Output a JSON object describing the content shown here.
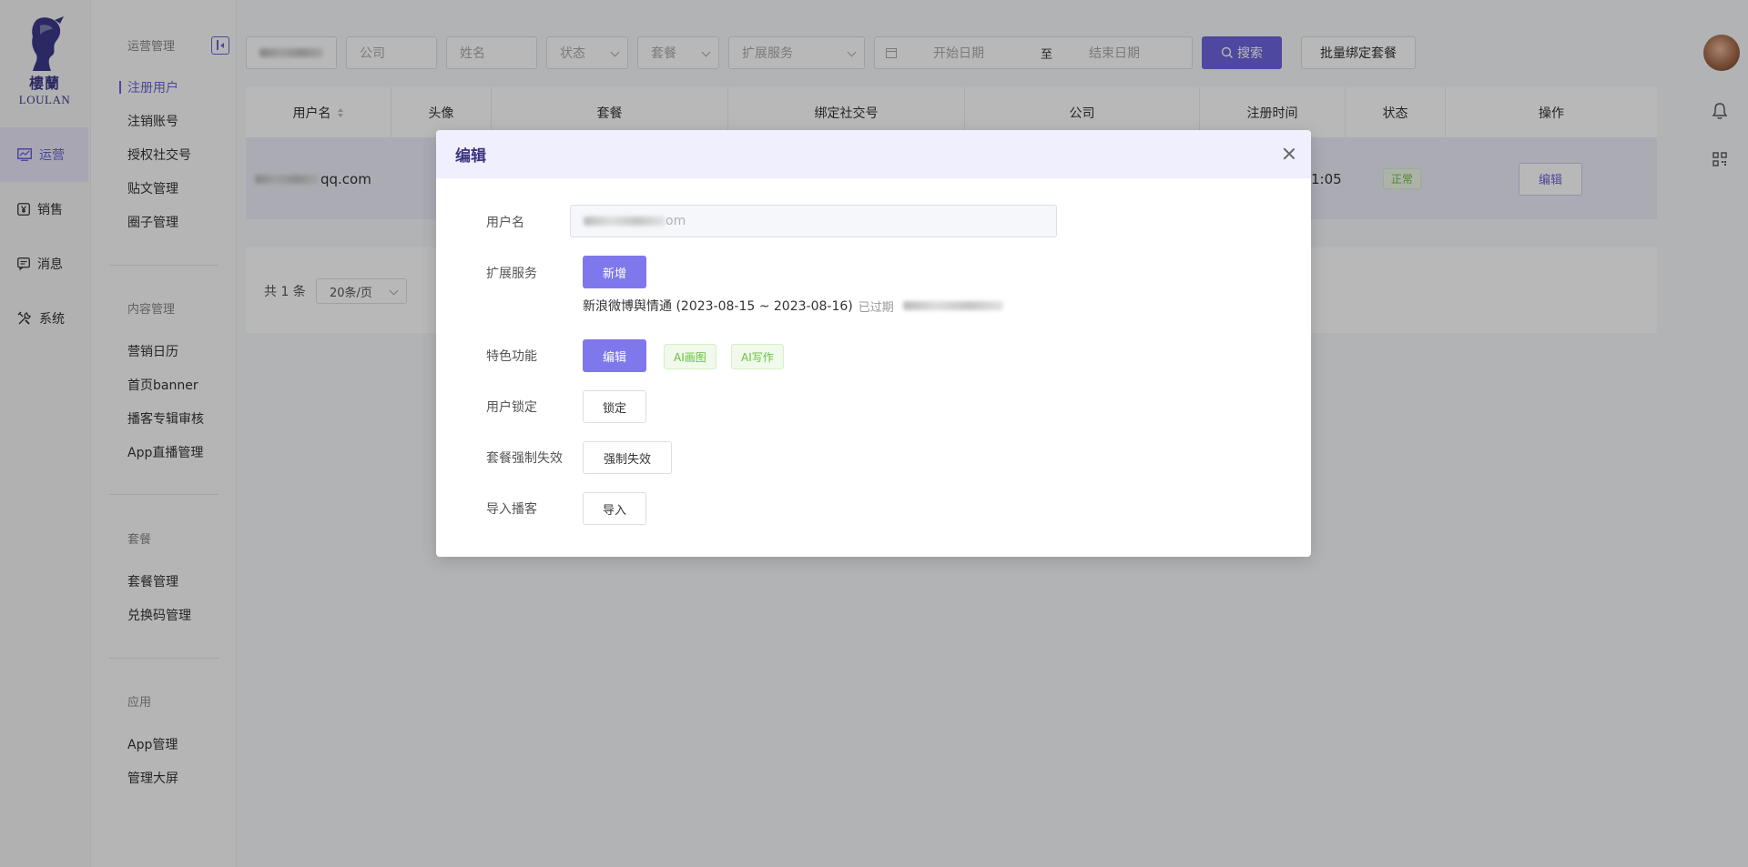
{
  "brand": {
    "name_cn": "樓蘭",
    "name_en": "LOULAN"
  },
  "rail": [
    {
      "label": "运营",
      "icon": "chart-icon",
      "active": true
    },
    {
      "label": "销售",
      "icon": "yen-icon"
    },
    {
      "label": "消息",
      "icon": "message-icon"
    },
    {
      "label": "系统",
      "icon": "tools-icon"
    }
  ],
  "subnav": {
    "groups": [
      {
        "title": "运营管理",
        "items": [
          "注册用户",
          "注销账号",
          "授权社交号",
          "贴文管理",
          "圈子管理"
        ]
      },
      {
        "title": "内容管理",
        "items": [
          "营销日历",
          "首页banner",
          "播客专辑审核",
          "App直播管理"
        ]
      },
      {
        "title": "套餐",
        "items": [
          "套餐管理",
          "兑换码管理"
        ]
      },
      {
        "title": "应用",
        "items": [
          "App管理",
          "管理大屏"
        ]
      }
    ],
    "active_item": "注册用户"
  },
  "filters": {
    "company_placeholder": "公司",
    "name_placeholder": "姓名",
    "status_placeholder": "状态",
    "package_placeholder": "套餐",
    "ext_service_placeholder": "扩展服务",
    "start_date_placeholder": "开始日期",
    "date_separator": "至",
    "end_date_placeholder": "结束日期",
    "search_label": "搜索",
    "batch_label": "批量绑定套餐"
  },
  "table": {
    "headers": [
      "用户名",
      "头像",
      "套餐",
      "绑定社交号",
      "公司",
      "注册时间",
      "状态",
      "操作"
    ],
    "row": {
      "username_suffix": "qq.com",
      "reg_time_tail": "1:05",
      "status": "正常",
      "action": "编辑"
    }
  },
  "pager": {
    "total": "共 1 条",
    "page_size": "20条/页"
  },
  "modal": {
    "title": "编辑",
    "username_label": "用户名",
    "username_value_suffix": "om",
    "ext_service_label": "扩展服务",
    "add_label": "新增",
    "service_line": "新浪微博舆情通 (2023-08-15 ~ 2023-08-16)",
    "service_expired": "已过期",
    "feature_label": "特色功能",
    "edit_label": "编辑",
    "feature_tags": [
      "AI画图",
      "AI写作"
    ],
    "lock_label": "用户锁定",
    "lock_btn": "锁定",
    "force_label": "套餐强制失效",
    "force_btn": "强制失效",
    "import_label": "导入播客",
    "import_btn": "导入"
  }
}
